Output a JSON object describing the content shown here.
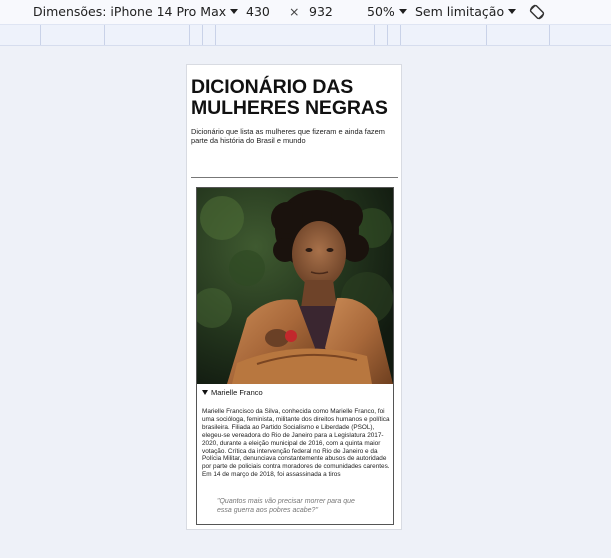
{
  "devtools": {
    "device_label": "Dimensões: iPhone 14 Pro Max",
    "width_value": "430",
    "times_symbol": "×",
    "height_value": "932",
    "zoom": "50%",
    "throttle": "Sem limitação",
    "rotate_icon": "rotate-icon"
  },
  "page": {
    "title": "DICIONÁRIO DAS MULHERES NEGRAS",
    "subtitle": "Dicionário que lista as mulheres que fizeram e ainda fazem parte da história do Brasil e mundo"
  },
  "card": {
    "summary": "Marielle Franco",
    "bio": "Marielle Francisco da Silva, conhecida como Marielle Franco, foi uma socióloga, feminista, militante dos direitos humanos e política brasileira. Filiada ao Partido Socialismo e Liberdade (PSOL), elegeu-se vereadora do Rio de Janeiro para a Legislatura 2017-2020, durante a eleição municipal de 2016, com a quinta maior votação. Crítica da intervenção federal no Rio de Janeiro e da Polícia Militar, denunciava constantemente abusos de autoridade por parte de policiais contra moradores de comunidades carentes. Em 14 de março de 2018, foi assassinada a tiros",
    "quote": "\"Quantos mais vão precisar morrer para que essa guerra aos pobres acabe?\""
  }
}
